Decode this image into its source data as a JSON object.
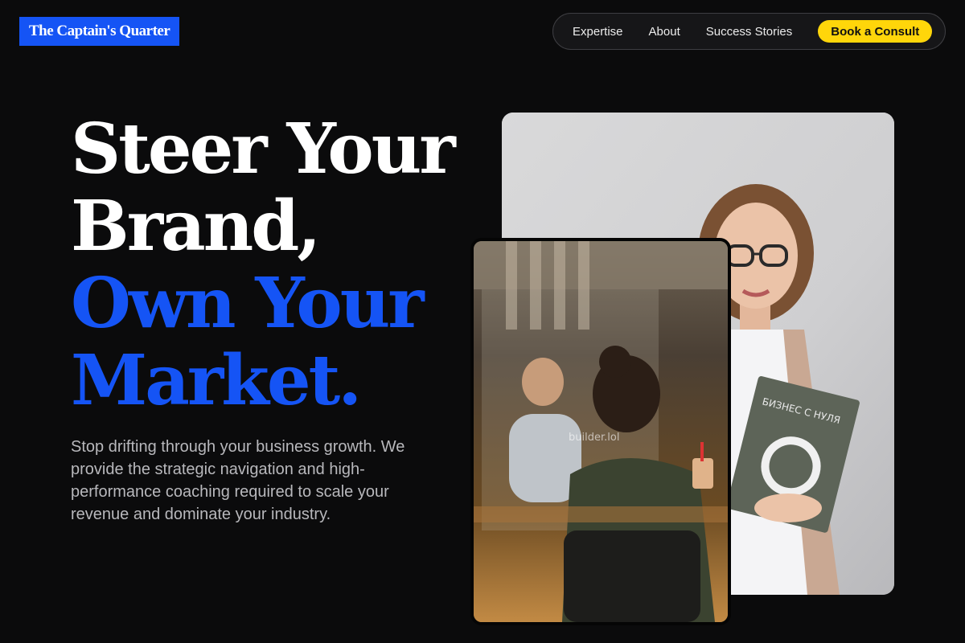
{
  "brand": {
    "name": "The Captain's Quarter"
  },
  "nav": {
    "links": [
      "Expertise",
      "About",
      "Success Stories"
    ],
    "cta": "Book a Consult"
  },
  "hero": {
    "headline_lines": [
      "Steer Your",
      "Brand,",
      "Own Your",
      "Market."
    ],
    "subtext": "Stop drifting through your business growth. We provide the strategic navigation and high-performance coaching required to scale your revenue and dominate your industry."
  },
  "images": {
    "back_book_title": "БИЗНЕС С НУЛЯ",
    "front_watermark": "builder.lol"
  },
  "colors": {
    "accent_blue": "#1554f5",
    "cta_yellow": "#ffd60a",
    "background": "#0b0b0c",
    "subtext_gray": "#b8b8bc"
  }
}
